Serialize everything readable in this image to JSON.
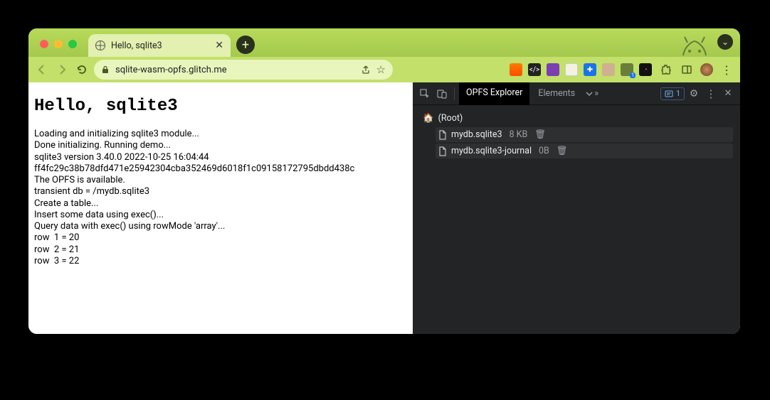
{
  "tab": {
    "title": "Hello, sqlite3"
  },
  "address": {
    "url": "sqlite-wasm-opfs.glitch.me"
  },
  "page": {
    "heading": "Hello, sqlite3",
    "lines": [
      "Loading and initializing sqlite3 module...",
      "Done initializing. Running demo...",
      "sqlite3 version 3.40.0 2022-10-25 16:04:44",
      "ff4fc29c38b78dfd471e25942304cba352469d6018f1c09158172795dbdd438c",
      "The OPFS is available.",
      "transient db = /mydb.sqlite3",
      "Create a table...",
      "Insert some data using exec()...",
      "Query data with exec() using rowMode 'array'...",
      "row  1 = 20",
      "row  2 = 21",
      "row  3 = 22"
    ]
  },
  "devtools": {
    "tabs": {
      "active": "OPFS Explorer",
      "next": "Elements"
    },
    "issuesCount": "1",
    "root": "(Root)",
    "files": [
      {
        "name": "mydb.sqlite3",
        "size": "8 KB"
      },
      {
        "name": "mydb.sqlite3-journal",
        "size": "0B"
      }
    ]
  },
  "icons": {
    "plus": "+",
    "close": "✕",
    "chevronDown": "⌄",
    "chevronRight": "›",
    "star": "☆",
    "share": "⎋",
    "lock": "🔒",
    "gear": "⚙",
    "more": "⋮",
    "trash": "🗑",
    "home": "🏠",
    "file": "🗎"
  }
}
